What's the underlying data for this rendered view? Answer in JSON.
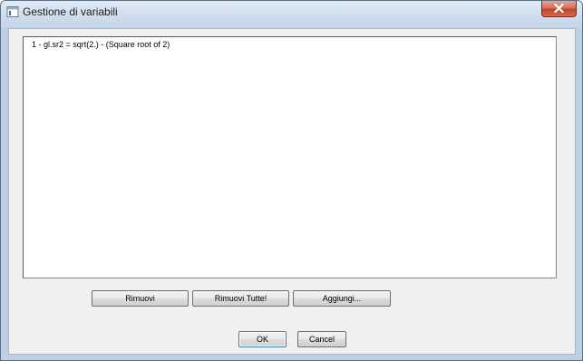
{
  "window": {
    "title": "Gestione di variabili",
    "icon": "window-app-icon",
    "close_icon": "close-icon"
  },
  "variables": {
    "items": [
      "1 - gl.sr2 = sqrt(2.) - (Square root of 2)"
    ]
  },
  "actions": {
    "remove_label": "Rimuovi",
    "remove_all_label": "Rimuovi Tutte!",
    "add_label": "Aggiungi..."
  },
  "dialog": {
    "ok_label": "OK",
    "cancel_label": "Cancel"
  },
  "colors": {
    "close_button": "#c7432b",
    "client_background": "#f0f0f0",
    "default_button_border": "#3c7fb1"
  }
}
